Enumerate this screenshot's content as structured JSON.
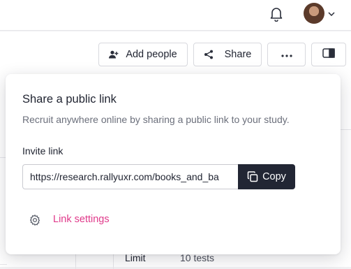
{
  "header": {
    "bell_icon": "bell-icon",
    "avatar_icon": "user-avatar",
    "caret_icon": "chevron-down-icon"
  },
  "toolbar": {
    "add_people_label": "Add people",
    "add_people_icon": "add-person-icon",
    "share_label": "Share",
    "share_icon": "share-icon",
    "more_icon": "more-horizontal-icon",
    "panel_icon": "sidebar-panel-icon"
  },
  "share_popover": {
    "title": "Share a public link",
    "description": "Recruit anywhere online by sharing a public link to your study.",
    "invite_label": "Invite link",
    "invite_url": "https://research.rallyuxr.com/books_and_ba",
    "copy_label": "Copy",
    "copy_icon": "copy-icon",
    "settings_label": "Link settings",
    "settings_icon": "gear-icon",
    "link_color": "#e0398a"
  },
  "background": {
    "limit_label": "Limit",
    "limit_value": "10 tests"
  }
}
